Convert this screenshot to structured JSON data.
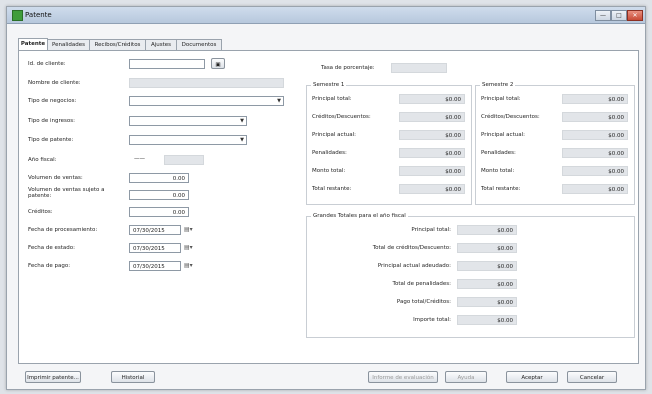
{
  "window": {
    "title": "Patente",
    "min_label": "—",
    "max_label": "□",
    "close_label": "✕"
  },
  "tabs": [
    "Patente",
    "Penalidades",
    "Recibos/Créditos",
    "Ajustes",
    "Documentos"
  ],
  "form": {
    "client_id_label": "Id. de cliente:",
    "client_name_label": "Nombre de cliente:",
    "business_type_label": "Tipo de negocios:",
    "income_type_label": "Tipo de ingresos:",
    "patent_type_label": "Tipo de patente:",
    "fiscal_year_label": "Año fiscal:",
    "fiscal_year_value": "——",
    "sales_volume_label": "Volumen de ventas:",
    "sales_volume_value": "0.00",
    "sales_volume_subject_label": "Volumen de ventas sujeto a patente:",
    "sales_volume_subject_value": "0.00",
    "credits_label": "Créditos:",
    "credits_value": "0.00",
    "processing_date_label": "Fecha de procesamiento:",
    "processing_date_value": "07/30/2015",
    "statement_date_label": "Fecha de estado:",
    "statement_date_value": "07/30/2015",
    "payment_date_label": "Fecha de pago:",
    "payment_date_value": "07/30/2015",
    "percent_rate_label": "Tasa de porcentaje:"
  },
  "semester1": {
    "title": "Semestre 1",
    "rows": [
      {
        "label": "Principal total:",
        "value": "$0.00"
      },
      {
        "label": "Créditos/Descuentos:",
        "value": "$0.00"
      },
      {
        "label": "Principal actual:",
        "value": "$0.00"
      },
      {
        "label": "Penalidades:",
        "value": "$0.00"
      },
      {
        "label": "Monto total:",
        "value": "$0.00"
      },
      {
        "label": "Total restante:",
        "value": "$0.00"
      }
    ]
  },
  "semester2": {
    "title": "Semestre 2",
    "rows": [
      {
        "label": "Principal total:",
        "value": "$0.00"
      },
      {
        "label": "Créditos/Descuentos:",
        "value": "$0.00"
      },
      {
        "label": "Principal actual:",
        "value": "$0.00"
      },
      {
        "label": "Penalidades:",
        "value": "$0.00"
      },
      {
        "label": "Monto total:",
        "value": "$0.00"
      },
      {
        "label": "Total restante:",
        "value": "$0.00"
      }
    ]
  },
  "totals": {
    "title": "Grandes Totales para el año fiscal",
    "rows": [
      {
        "label": "Principal total:",
        "value": "$0.00"
      },
      {
        "label": "Total de créditos/Descuento:",
        "value": "$0.00"
      },
      {
        "label": "Principal actual adeudado:",
        "value": "$0.00"
      },
      {
        "label": "Total de penalidades:",
        "value": "$0.00"
      },
      {
        "label": "Pago total/Créditos:",
        "value": "$0.00"
      },
      {
        "label": "Importe total:",
        "value": "$0.00"
      }
    ]
  },
  "buttons": {
    "print_patent": "Imprimir patente...",
    "history": "Historial",
    "report": "Informe de evaluación",
    "help": "Ayuda",
    "accept": "Aceptar",
    "cancel": "Cancelar"
  }
}
